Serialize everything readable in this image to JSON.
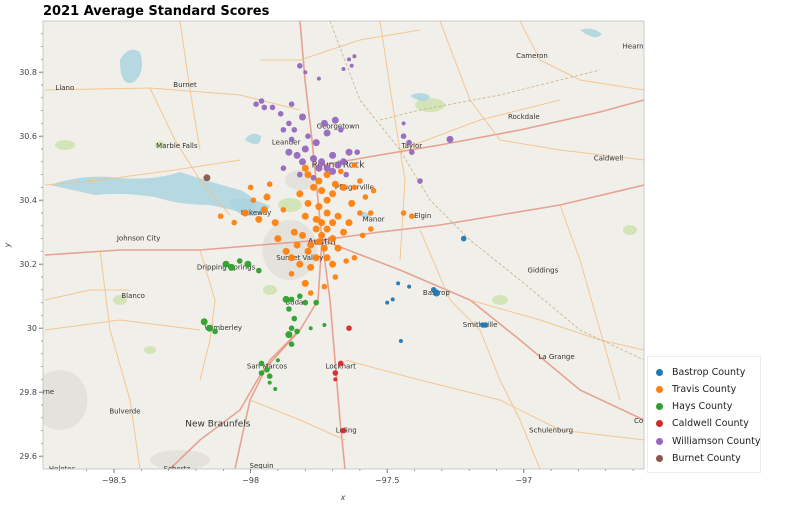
{
  "title": "2021 Average Standard Scores",
  "colors": {
    "map_bg": "#f1efe9",
    "water": "#aad3df",
    "park": "#cfe3b3",
    "road_major": "#e58e7c",
    "road_minor": "#f4bf82",
    "road_rail": "#c6a97b",
    "urban": "#dcd8d3"
  },
  "chart_data": {
    "type": "scatter",
    "title": "2021 Average Standard Scores",
    "xlabel": "x",
    "ylabel": "y",
    "xlim": [
      -98.76,
      -96.56
    ],
    "ylim": [
      29.56,
      30.96
    ],
    "xticks": [
      -98.5,
      -98,
      -97.5,
      -97
    ],
    "xtick_labels": [
      "−98.5",
      "−98",
      "−97.5",
      "−97"
    ],
    "yticks": [
      29.6,
      29.8,
      30,
      30.2,
      30.4,
      30.6,
      30.8
    ],
    "ytick_labels": [
      "29.6",
      "29.8",
      "30",
      "30.2",
      "30.4",
      "30.6",
      "30.8"
    ],
    "legend_position": "bottom-right",
    "series": [
      {
        "name": "Bastrop County",
        "color": "#1f77b4",
        "points": [
          [
            -97.46,
            30.14,
            2
          ],
          [
            -97.42,
            30.13,
            2
          ],
          [
            -97.32,
            30.11,
            4
          ],
          [
            -97.33,
            30.12,
            3
          ],
          [
            -97.22,
            30.28,
            3
          ],
          [
            -97.15,
            30.01,
            3
          ],
          [
            -97.14,
            30.01,
            3
          ],
          [
            -97.48,
            30.09,
            2
          ],
          [
            -97.5,
            30.08,
            2
          ],
          [
            -97.45,
            29.96,
            2
          ]
        ]
      },
      {
        "name": "Travis County",
        "color": "#ff7f0e",
        "points": [
          [
            -97.75,
            30.27,
            4
          ],
          [
            -97.74,
            30.29,
            4
          ],
          [
            -97.72,
            30.31,
            4
          ],
          [
            -97.76,
            30.31,
            4
          ],
          [
            -97.78,
            30.26,
            4
          ],
          [
            -97.7,
            30.28,
            4
          ],
          [
            -97.73,
            30.25,
            4
          ],
          [
            -97.72,
            30.22,
            4
          ],
          [
            -97.76,
            30.22,
            4
          ],
          [
            -97.79,
            30.24,
            4
          ],
          [
            -97.7,
            30.33,
            4
          ],
          [
            -97.68,
            30.35,
            4
          ],
          [
            -97.72,
            30.36,
            4
          ],
          [
            -97.75,
            30.38,
            4
          ],
          [
            -97.72,
            30.4,
            4
          ],
          [
            -97.7,
            30.42,
            4
          ],
          [
            -97.74,
            30.43,
            4
          ],
          [
            -97.77,
            30.44,
            4
          ],
          [
            -97.79,
            30.39,
            4
          ],
          [
            -97.8,
            30.35,
            4
          ],
          [
            -97.66,
            30.3,
            4
          ],
          [
            -97.64,
            30.33,
            4
          ],
          [
            -97.68,
            30.25,
            4
          ],
          [
            -97.7,
            30.2,
            4
          ],
          [
            -97.78,
            30.19,
            4
          ],
          [
            -97.82,
            30.2,
            4
          ],
          [
            -97.85,
            30.22,
            4
          ],
          [
            -97.87,
            30.24,
            4
          ],
          [
            -97.84,
            30.3,
            4
          ],
          [
            -97.82,
            30.42,
            4
          ],
          [
            -97.75,
            30.46,
            4
          ],
          [
            -97.69,
            30.45,
            4
          ],
          [
            -97.66,
            30.44,
            4
          ],
          [
            -97.63,
            30.39,
            4
          ],
          [
            -97.6,
            30.36,
            3
          ],
          [
            -97.62,
            30.44,
            3
          ],
          [
            -97.58,
            30.41,
            3
          ],
          [
            -97.55,
            30.43,
            3
          ],
          [
            -97.56,
            30.36,
            3
          ],
          [
            -97.6,
            30.46,
            3
          ],
          [
            -97.72,
            30.48,
            4
          ],
          [
            -97.79,
            30.48,
            4
          ],
          [
            -97.8,
            30.5,
            4
          ],
          [
            -97.94,
            30.41,
            4
          ],
          [
            -97.95,
            30.37,
            4
          ],
          [
            -97.97,
            30.34,
            4
          ],
          [
            -98.02,
            30.36,
            4
          ],
          [
            -98.06,
            30.33,
            3
          ],
          [
            -98.11,
            30.35,
            3
          ],
          [
            -98.0,
            30.44,
            3
          ],
          [
            -97.99,
            30.4,
            3
          ],
          [
            -97.91,
            30.33,
            4
          ],
          [
            -97.9,
            30.28,
            4
          ],
          [
            -97.85,
            30.17,
            3
          ],
          [
            -97.8,
            30.14,
            4
          ],
          [
            -97.78,
            30.11,
            3
          ],
          [
            -97.73,
            30.13,
            3
          ],
          [
            -97.69,
            30.16,
            3
          ],
          [
            -97.65,
            30.21,
            3
          ],
          [
            -97.62,
            30.22,
            3
          ],
          [
            -97.59,
            30.29,
            3
          ],
          [
            -97.56,
            30.31,
            3
          ],
          [
            -97.44,
            30.36,
            3
          ],
          [
            -97.41,
            30.35,
            3
          ],
          [
            -97.67,
            30.49,
            3
          ],
          [
            -97.62,
            30.51,
            3
          ],
          [
            -97.88,
            30.37,
            3
          ],
          [
            -97.93,
            30.45,
            3
          ],
          [
            -97.81,
            30.29,
            4
          ],
          [
            -97.83,
            30.26,
            4
          ],
          [
            -97.76,
            30.34,
            4
          ],
          [
            -97.74,
            30.33,
            4
          ]
        ]
      },
      {
        "name": "Hays County",
        "color": "#2ca02c",
        "points": [
          [
            -98.09,
            30.2,
            4
          ],
          [
            -98.07,
            30.19,
            4
          ],
          [
            -98.04,
            30.21,
            3
          ],
          [
            -98.01,
            30.2,
            4
          ],
          [
            -97.97,
            30.18,
            3
          ],
          [
            -97.87,
            30.09,
            4
          ],
          [
            -97.85,
            30.09,
            3
          ],
          [
            -97.82,
            30.1,
            3
          ],
          [
            -97.8,
            30.08,
            3
          ],
          [
            -97.76,
            30.08,
            3
          ],
          [
            -97.86,
            30.06,
            3
          ],
          [
            -97.84,
            30.03,
            3
          ],
          [
            -97.85,
            30.0,
            3
          ],
          [
            -97.86,
            29.98,
            4
          ],
          [
            -97.83,
            29.99,
            3
          ],
          [
            -97.85,
            29.95,
            3
          ],
          [
            -97.78,
            30.0,
            2
          ],
          [
            -97.73,
            30.01,
            2
          ],
          [
            -98.17,
            30.02,
            4
          ],
          [
            -98.15,
            30.0,
            4
          ],
          [
            -98.13,
            29.99,
            3
          ],
          [
            -97.96,
            29.89,
            3
          ],
          [
            -97.94,
            29.87,
            3
          ],
          [
            -97.93,
            29.85,
            3
          ],
          [
            -97.96,
            29.86,
            3
          ],
          [
            -97.93,
            29.83,
            2
          ],
          [
            -97.91,
            29.81,
            2
          ],
          [
            -97.9,
            29.9,
            2
          ]
        ]
      },
      {
        "name": "Caldwell County",
        "color": "#d62728",
        "points": [
          [
            -97.64,
            30.0,
            3
          ],
          [
            -97.67,
            29.89,
            3
          ],
          [
            -97.69,
            29.86,
            3
          ],
          [
            -97.69,
            29.84,
            2
          ],
          [
            -97.66,
            29.68,
            3
          ]
        ]
      },
      {
        "name": "Williamson County",
        "color": "#9467bd",
        "points": [
          [
            -97.75,
            30.78,
            2
          ],
          [
            -97.82,
            30.82,
            3
          ],
          [
            -97.66,
            30.81,
            2
          ],
          [
            -97.64,
            30.84,
            2
          ],
          [
            -97.62,
            30.85,
            2
          ],
          [
            -97.63,
            30.82,
            2
          ],
          [
            -97.8,
            30.8,
            2
          ],
          [
            -97.73,
            30.64,
            4
          ],
          [
            -97.69,
            30.65,
            4
          ],
          [
            -97.67,
            30.62,
            3
          ],
          [
            -97.72,
            30.61,
            4
          ],
          [
            -97.76,
            30.58,
            4
          ],
          [
            -97.8,
            30.56,
            4
          ],
          [
            -97.83,
            30.54,
            4
          ],
          [
            -97.86,
            30.55,
            4
          ],
          [
            -97.81,
            30.52,
            4
          ],
          [
            -97.77,
            30.53,
            4
          ],
          [
            -97.74,
            30.52,
            4
          ],
          [
            -97.7,
            30.54,
            4
          ],
          [
            -97.68,
            30.51,
            4
          ],
          [
            -97.66,
            30.52,
            4
          ],
          [
            -97.64,
            30.55,
            4
          ],
          [
            -97.61,
            30.55,
            3
          ],
          [
            -97.86,
            30.64,
            3
          ],
          [
            -97.89,
            30.67,
            3
          ],
          [
            -97.92,
            30.69,
            3
          ],
          [
            -97.88,
            30.62,
            3
          ],
          [
            -97.84,
            30.62,
            3
          ],
          [
            -97.85,
            30.59,
            3
          ],
          [
            -97.79,
            30.6,
            3
          ],
          [
            -97.75,
            30.5,
            4
          ],
          [
            -97.72,
            30.5,
            4
          ],
          [
            -97.7,
            30.49,
            4
          ],
          [
            -97.65,
            30.48,
            3
          ],
          [
            -97.77,
            30.47,
            3
          ],
          [
            -97.82,
            30.48,
            3
          ],
          [
            -97.88,
            30.5,
            3
          ],
          [
            -97.44,
            30.6,
            3
          ],
          [
            -97.42,
            30.58,
            3
          ],
          [
            -97.41,
            30.55,
            3
          ],
          [
            -97.38,
            30.46,
            3
          ],
          [
            -97.27,
            30.59,
            4
          ],
          [
            -97.44,
            30.64,
            2
          ],
          [
            -97.81,
            30.66,
            4
          ],
          [
            -97.85,
            30.7,
            3
          ],
          [
            -97.95,
            30.69,
            3
          ],
          [
            -97.96,
            30.71,
            3
          ],
          [
            -97.98,
            30.7,
            3
          ]
        ]
      },
      {
        "name": "Burnet County",
        "color": "#8c564b",
        "points": [
          [
            -98.16,
            30.47,
            4
          ]
        ]
      }
    ]
  },
  "places": [
    {
      "name": "Llano",
      "x": -98.68,
      "y": 30.75
    },
    {
      "name": "Burnet",
      "x": -98.24,
      "y": 30.76
    },
    {
      "name": "Marble Falls",
      "x": -98.27,
      "y": 30.57
    },
    {
      "name": "Leander",
      "x": -97.87,
      "y": 30.58
    },
    {
      "name": "Georgetown",
      "x": -97.68,
      "y": 30.63
    },
    {
      "name": "Taylor",
      "x": -97.41,
      "y": 30.57
    },
    {
      "name": "Round Rock",
      "x": -97.68,
      "y": 30.51
    },
    {
      "name": "Pflugerville",
      "x": -97.62,
      "y": 30.44
    },
    {
      "name": "Lakeway",
      "x": -97.98,
      "y": 30.36
    },
    {
      "name": "Manor",
      "x": -97.55,
      "y": 30.34
    },
    {
      "name": "Elgin",
      "x": -97.37,
      "y": 30.35
    },
    {
      "name": "Johnson City",
      "x": -98.41,
      "y": 30.28
    },
    {
      "name": "Austin",
      "x": -97.74,
      "y": 30.27
    },
    {
      "name": "Sunset Valley",
      "x": -97.82,
      "y": 30.22
    },
    {
      "name": "Dripping Springs",
      "x": -98.09,
      "y": 30.19
    },
    {
      "name": "Blanco",
      "x": -98.43,
      "y": 30.1
    },
    {
      "name": "Buda",
      "x": -97.84,
      "y": 30.08
    },
    {
      "name": "Bastrop",
      "x": -97.32,
      "y": 30.11
    },
    {
      "name": "Wimberley",
      "x": -98.1,
      "y": 30.0
    },
    {
      "name": "Smithville",
      "x": -97.16,
      "y": 30.01
    },
    {
      "name": "San Marcos",
      "x": -97.94,
      "y": 29.88
    },
    {
      "name": "Lockhart",
      "x": -97.67,
      "y": 29.88
    },
    {
      "name": "Bulverde",
      "x": -98.46,
      "y": 29.74
    },
    {
      "name": "New Braunfels",
      "x": -98.12,
      "y": 29.7
    },
    {
      "name": "Luling",
      "x": -97.65,
      "y": 29.68
    },
    {
      "name": "Schertz",
      "x": -98.27,
      "y": 29.56
    },
    {
      "name": "Seguin",
      "x": -97.96,
      "y": 29.57
    },
    {
      "name": "Helotes",
      "x": -98.69,
      "y": 29.56
    },
    {
      "name": "Cameron",
      "x": -96.97,
      "y": 30.85
    },
    {
      "name": "Rockdale",
      "x": -97.0,
      "y": 30.66
    },
    {
      "name": "Caldwell",
      "x": -96.69,
      "y": 30.53
    },
    {
      "name": "Giddings",
      "x": -96.93,
      "y": 30.18
    },
    {
      "name": "La Grange",
      "x": -96.88,
      "y": 29.91
    },
    {
      "name": "Schulenburg",
      "x": -96.9,
      "y": 29.68
    },
    {
      "name": "Hearn",
      "x": -96.6,
      "y": 30.88
    },
    {
      "name": "rne",
      "x": -98.74,
      "y": 29.8
    },
    {
      "name": "Co",
      "x": -96.58,
      "y": 29.71
    }
  ]
}
